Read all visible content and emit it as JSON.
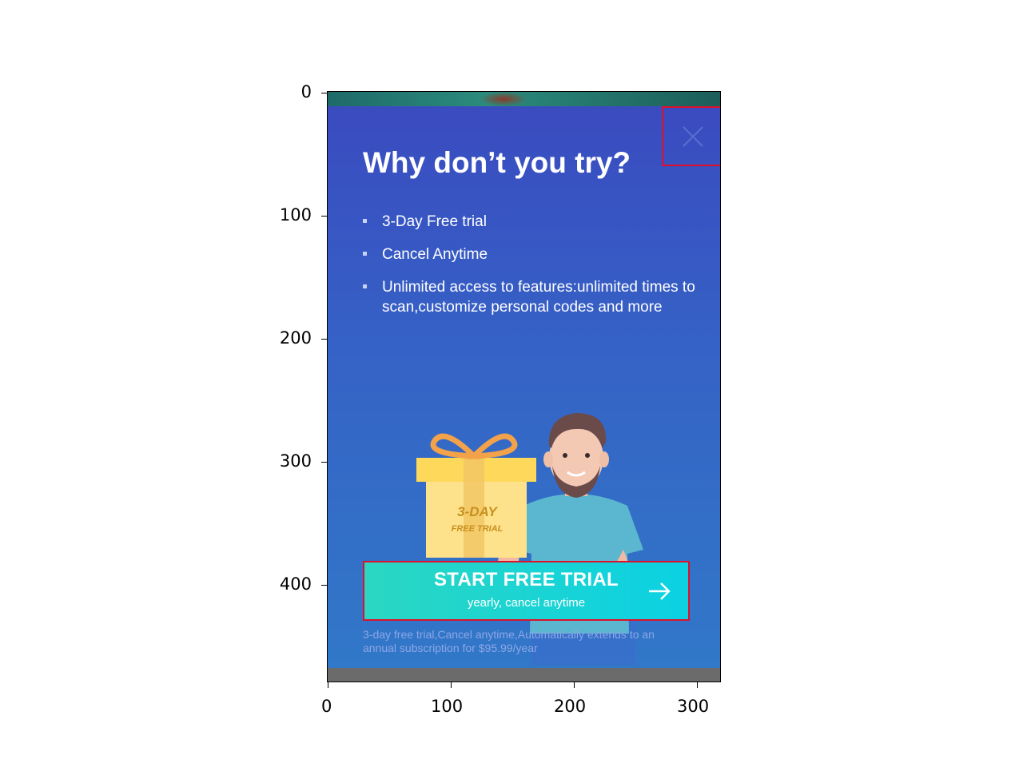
{
  "axes": {
    "x_ticks": [
      "0",
      "100",
      "200",
      "300"
    ],
    "y_ticks": [
      "0",
      "100",
      "200",
      "300",
      "400"
    ]
  },
  "dialog": {
    "title": "Why don’t you try?",
    "bullets": [
      "3-Day Free trial",
      "Cancel Anytime",
      "Unlimited access to features:unlimited times to scan,customize personal codes and more"
    ],
    "gift_box": {
      "line1": "3-DAY",
      "line2": "FREE TRIAL"
    },
    "cta": {
      "title": "START FREE TRIAL",
      "subtitle": "yearly, cancel anytime",
      "icon": "arrow-right-icon"
    },
    "disclaimer": "3-day free trial,Cancel anytime,Automatically extends to an annual subscription for $95.99/year",
    "close_icon": "close-icon"
  },
  "colors": {
    "dialog_top": "#3a4bc0",
    "dialog_bottom": "#3178c8",
    "cta_start": "#2bd7c2",
    "cta_end": "#0bd1e3",
    "highlight_box": "#e0102a"
  }
}
